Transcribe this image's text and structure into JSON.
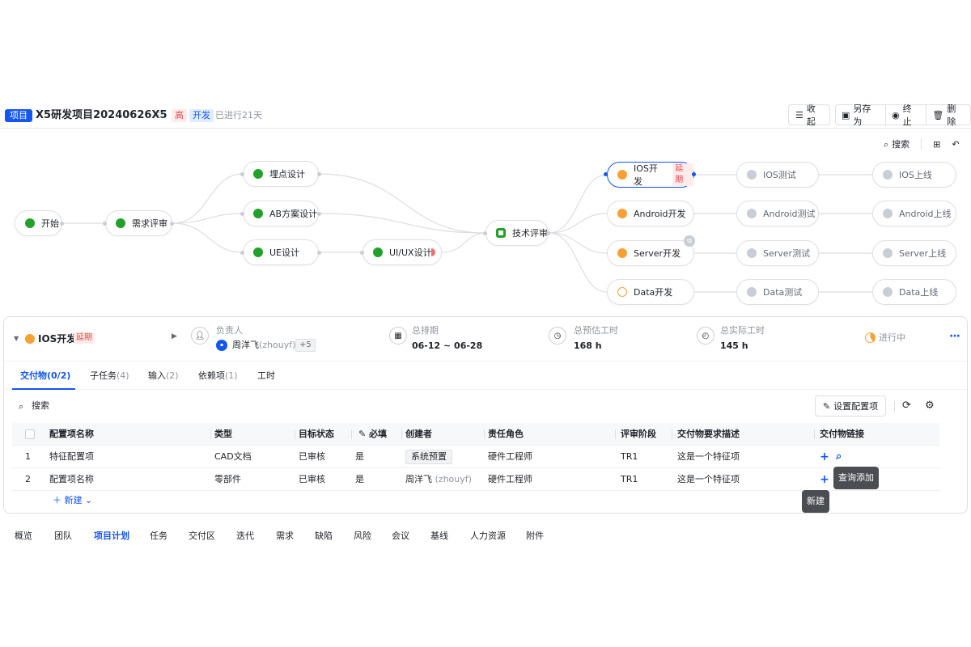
{
  "header": {
    "type_tag": "项目",
    "title": "X5研发项目20240626X5",
    "star_icon": "star-icon",
    "priority": "高",
    "phase": "开发",
    "elapsed": "已进行21天",
    "buttons": {
      "collapse": "收起",
      "save_as": "另存为",
      "stop": "终止",
      "delete": "删除"
    }
  },
  "flow": {
    "tools": {
      "search": "搜索"
    },
    "nodes": {
      "start": {
        "label": "开始",
        "status": "done"
      },
      "req_review": {
        "label": "需求评审",
        "status": "done"
      },
      "tracking": {
        "label": "埋点设计",
        "status": "done"
      },
      "ab": {
        "label": "AB方案设计",
        "status": "done"
      },
      "ue": {
        "label": "UE设计",
        "status": "done"
      },
      "uiux": {
        "label": "UI/UX设计",
        "status": "done"
      },
      "tech_review": {
        "label": "技术评审",
        "status": "done"
      },
      "ios_dev": {
        "label": "IOS开发",
        "status": "in-progress",
        "tag": "延期"
      },
      "android_dev": {
        "label": "Android开发",
        "status": "in-progress"
      },
      "server_dev": {
        "label": "Server开发",
        "status": "in-progress"
      },
      "data_dev": {
        "label": "Data开发",
        "status": "not-started"
      },
      "ios_test": {
        "label": "IOS测试",
        "status": "pending"
      },
      "android_test": {
        "label": "Android测试",
        "status": "pending"
      },
      "server_test": {
        "label": "Server测试",
        "status": "pending"
      },
      "data_test": {
        "label": "Data测试",
        "status": "pending"
      },
      "ios_launch": {
        "label": "IOS上线",
        "status": "pending"
      },
      "android_launch": {
        "label": "Android上线",
        "status": "pending"
      },
      "server_launch": {
        "label": "Server上线",
        "status": "pending"
      },
      "data_launch": {
        "label": "Data上线",
        "status": "pending"
      }
    },
    "colors": {
      "done": "#22a12a",
      "in_progress": "#f7a035",
      "pending": "#c9cdd4",
      "selected_border": "#1456f0"
    }
  },
  "detail": {
    "title": "IOS开发",
    "delay_tag": "延期",
    "owner_label": "负责人",
    "owner_name": "周洋飞",
    "owner_en": "(zhouyf)",
    "owner_more": "+5",
    "schedule_label": "总排期",
    "schedule_value": "06-12 ~ 06-28",
    "est_label": "总预估工时",
    "est_value": "168 h",
    "actual_label": "总实际工时",
    "actual_value": "145 h",
    "status": "进行中",
    "tabs": [
      {
        "label": "交付物",
        "count": "(0/2)"
      },
      {
        "label": "子任务",
        "count": "(4)"
      },
      {
        "label": "输入",
        "count": "(2)"
      },
      {
        "label": "依赖项",
        "count": "(1)"
      },
      {
        "label": "工时",
        "count": ""
      }
    ],
    "search": "搜索",
    "config_button": "设置配置项",
    "table": {
      "columns": [
        "配置项名称",
        "类型",
        "目标状态",
        "必填",
        "创建者",
        "责任角色",
        "评审阶段",
        "交付物要求描述",
        "交付物链接"
      ],
      "rows": [
        {
          "index": "1",
          "name": "特征配置项",
          "type": "CAD文档",
          "target": "已审核",
          "required": "是",
          "creator": "系统预置",
          "creator_en": "",
          "role": "硬件工程师",
          "stage": "TR1",
          "desc": "这是一个特征项"
        },
        {
          "index": "2",
          "name": "配置项名称",
          "type": "零部件",
          "target": "已审核",
          "required": "是",
          "creator": "周洋飞",
          "creator_en": "(zhouyf)",
          "role": "硬件工程师",
          "stage": "TR1",
          "desc": "这是一个特征项"
        }
      ]
    },
    "new_row": "新建",
    "tooltips": {
      "query_add": "查询添加",
      "new": "新建"
    }
  },
  "bottom_nav": [
    "概览",
    "团队",
    "项目计划",
    "任务",
    "交付区",
    "迭代",
    "需求",
    "缺陷",
    "风险",
    "会议",
    "基线",
    "人力资源",
    "附件"
  ],
  "bottom_nav_active": "项目计划"
}
